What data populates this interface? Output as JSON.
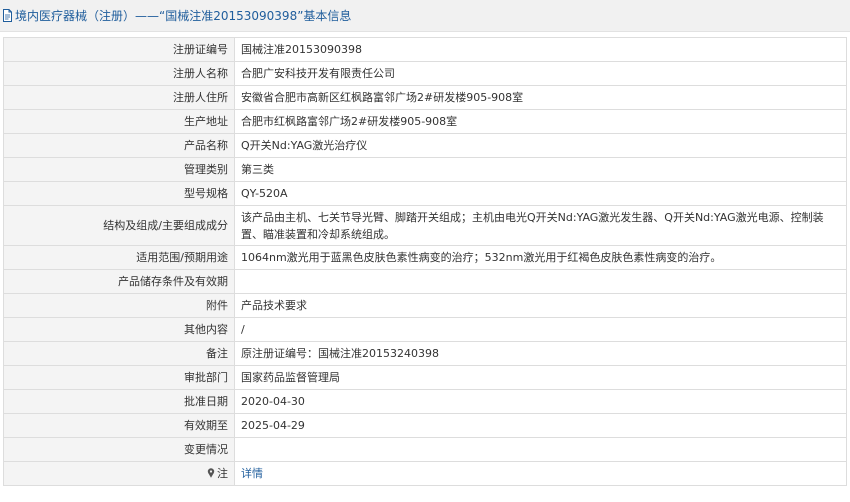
{
  "header": {
    "title": "境内医疗器械（注册）——“国械注准20153090398”基本信息",
    "icon": "document-icon",
    "color": "#1f5d9c"
  },
  "rows": [
    {
      "label": "注册证编号",
      "value": "国械注准20153090398"
    },
    {
      "label": "注册人名称",
      "value": "合肥广安科技开发有限责任公司"
    },
    {
      "label": "注册人住所",
      "value": "安徽省合肥市高新区红枫路富邻广场2#研发楼905-908室"
    },
    {
      "label": "生产地址",
      "value": "合肥市红枫路富邻广场2#研发楼905-908室"
    },
    {
      "label": "产品名称",
      "value": "Q开关Nd:YAG激光治疗仪"
    },
    {
      "label": "管理类别",
      "value": "第三类"
    },
    {
      "label": "型号规格",
      "value": "QY-520A"
    },
    {
      "label": "结构及组成/主要组成成分",
      "value": "该产品由主机、七关节导光臂、脚踏开关组成；主机由电光Q开关Nd:YAG激光发生器、Q开关Nd:YAG激光电源、控制装置、瞄准装置和冷却系统组成。"
    },
    {
      "label": "适用范围/预期用途",
      "value": "1064nm激光用于蓝黑色皮肤色素性病变的治疗；532nm激光用于红褐色皮肤色素性病变的治疗。"
    },
    {
      "label": "产品储存条件及有效期",
      "value": ""
    },
    {
      "label": "附件",
      "value": "产品技术要求"
    },
    {
      "label": "其他内容",
      "value": "/"
    },
    {
      "label": "备注",
      "value": "原注册证编号：国械注准20153240398"
    },
    {
      "label": "审批部门",
      "value": "国家药品监督管理局"
    },
    {
      "label": "批准日期",
      "value": "2020-04-30"
    },
    {
      "label": "有效期至",
      "value": "2025-04-29"
    },
    {
      "label": "变更情况",
      "value": ""
    }
  ],
  "note_row": {
    "label": "注",
    "icon": "pin-icon",
    "link_text": "详情",
    "link_color": "#1f5d9c"
  }
}
